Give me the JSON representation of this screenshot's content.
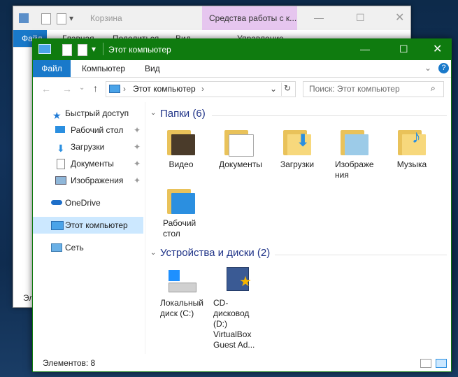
{
  "back_window": {
    "title": "Корзина",
    "context_tab": "Средства работы с к...",
    "tabs": [
      "Файл",
      "Главная",
      "Поделиться",
      "Вид",
      "Управление"
    ],
    "status_fragment": "Эл"
  },
  "window": {
    "title": "Этот компьютер",
    "ribbon": {
      "file": "Файл",
      "computer": "Компьютер",
      "view": "Вид"
    },
    "address": {
      "location": "Этот компьютер"
    },
    "search": {
      "placeholder": "Поиск: Этот компьютер"
    },
    "sidebar": {
      "items": [
        {
          "label": "Быстрый доступ"
        },
        {
          "label": "Рабочий стол"
        },
        {
          "label": "Загрузки"
        },
        {
          "label": "Документы"
        },
        {
          "label": "Изображения"
        },
        {
          "label": "OneDrive"
        },
        {
          "label": "Этот компьютер"
        },
        {
          "label": "Сеть"
        }
      ]
    },
    "groups": {
      "folders": {
        "title": "Папки (6)",
        "items": [
          "Видео",
          "Документы",
          "Загрузки",
          "Изображения",
          "Музыка",
          "Рабочий стол"
        ]
      },
      "devices": {
        "title": "Устройства и диски (2)",
        "items": [
          "Локальный диск (C:)",
          "CD-дисковод (D:) VirtualBox Guest Ad..."
        ]
      }
    },
    "status": "Элементов: 8"
  },
  "colors": {
    "titlebar": "#0f7b0f",
    "file_tab": "#1979ca",
    "group_title": "#1e3287",
    "selected": "#cce8ff"
  }
}
